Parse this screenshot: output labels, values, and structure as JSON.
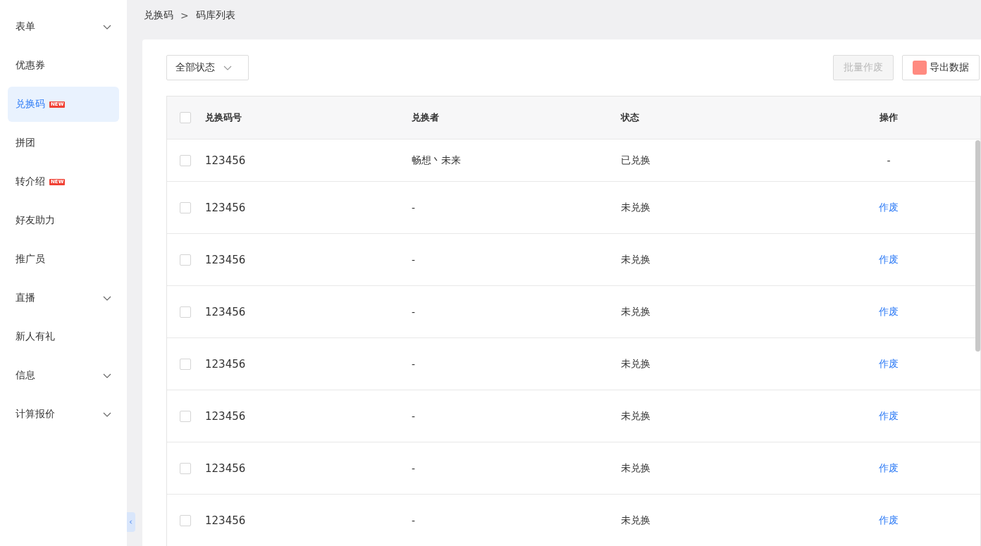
{
  "sidebar": {
    "items": [
      {
        "label": "表单",
        "selected": false,
        "expandable": true
      },
      {
        "label": "优惠券",
        "selected": false,
        "expandable": false
      },
      {
        "label": "兑换码",
        "selected": true,
        "expandable": false,
        "badge": "NEW"
      },
      {
        "label": "拼团",
        "selected": false,
        "expandable": false
      },
      {
        "label": "转介绍",
        "selected": false,
        "expandable": false,
        "badge": "NEW"
      },
      {
        "label": "好友助力",
        "selected": false,
        "expandable": false
      },
      {
        "label": "推广员",
        "selected": false,
        "expandable": false
      },
      {
        "label": "直播",
        "selected": false,
        "expandable": true
      },
      {
        "label": "新人有礼",
        "selected": false,
        "expandable": false
      },
      {
        "label": "信息",
        "selected": false,
        "expandable": true
      },
      {
        "label": "计算报价",
        "selected": false,
        "expandable": true
      }
    ]
  },
  "breadcrumb": [
    "兑换码",
    "码库列表"
  ],
  "breadcrumb_separator": ">",
  "filter": {
    "value": "全部状态"
  },
  "buttons": [
    {
      "label": "批量作废",
      "disabled": true,
      "icon": false
    },
    {
      "label": "导出数据",
      "disabled": false,
      "icon": true
    }
  ],
  "table": {
    "header_checked": false,
    "columns": [
      "兑换码号",
      "兑换者",
      "状态",
      "操作"
    ],
    "rows": [
      {
        "checked": false,
        "code": "123456",
        "redeemer": "畅想丶未来",
        "status": "已兑换",
        "action": {
          "kind": "text",
          "label": "-"
        }
      },
      {
        "checked": false,
        "code": "123456",
        "redeemer": "-",
        "status": "未兑换",
        "action": {
          "kind": "link",
          "label": "作废"
        }
      },
      {
        "checked": false,
        "code": "123456",
        "redeemer": "-",
        "status": "未兑换",
        "action": {
          "kind": "link",
          "label": "作废"
        }
      },
      {
        "checked": false,
        "code": "123456",
        "redeemer": "-",
        "status": "未兑换",
        "action": {
          "kind": "link",
          "label": "作废"
        }
      },
      {
        "checked": false,
        "code": "123456",
        "redeemer": "-",
        "status": "未兑换",
        "action": {
          "kind": "link",
          "label": "作废"
        }
      },
      {
        "checked": false,
        "code": "123456",
        "redeemer": "-",
        "status": "未兑换",
        "action": {
          "kind": "link",
          "label": "作废"
        }
      },
      {
        "checked": false,
        "code": "123456",
        "redeemer": "-",
        "status": "未兑换",
        "action": {
          "kind": "link",
          "label": "作废"
        }
      },
      {
        "checked": false,
        "code": "123456",
        "redeemer": "-",
        "status": "未兑换",
        "action": {
          "kind": "link",
          "label": "作废"
        }
      }
    ]
  }
}
